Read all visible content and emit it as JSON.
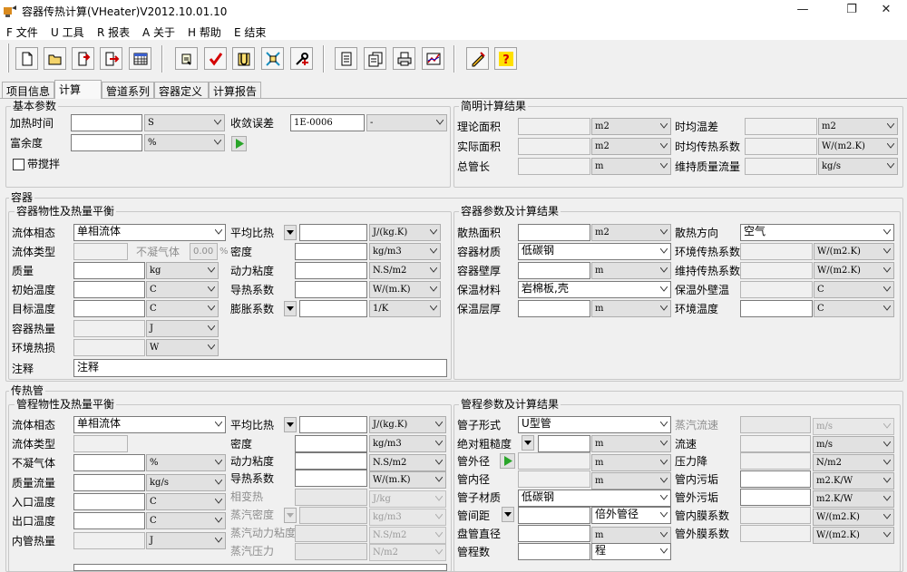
{
  "app": {
    "title": "容器传热计算(VHeater)V2012.10.01.10"
  },
  "menu": [
    "F 文件",
    "U 工具",
    "R 报表",
    "A 关于",
    "H 帮助",
    "E 结束"
  ],
  "tabs": [
    "项目信息",
    "计算",
    "管道系列",
    "容器定义",
    "计算报告"
  ],
  "basic": {
    "title": "基本参数",
    "heat_time_label": "加热时间",
    "heat_time_unit": "S",
    "margin_label": "富余度",
    "margin_unit": "%",
    "tol_label": "收敛误差",
    "tol_value": "1E-0006",
    "tol_unit": "-",
    "stir_label": "带搅拌"
  },
  "summary": {
    "title": "简明计算结果",
    "theo_area": "理论面积",
    "actual_area": "实际面积",
    "total_len": "总管长",
    "avg_dt": "时均温差",
    "avg_k": "时均传热系数",
    "maint_flow": "维持质量流量",
    "u_m2": "m2",
    "u_m": "m",
    "u_wm2k": "W/(m2.K)",
    "u_kgs": "kg/s"
  },
  "vessel": {
    "title": "容器",
    "sub_title": "容器物性及热量平衡",
    "phase_label": "流体相态",
    "phase_value": "单相流体",
    "ftype_label": "流体类型",
    "ncg_label": "不凝气体",
    "ncg_value": "0.00",
    "pct": "%",
    "mass_label": "质量",
    "mass_unit": "kg",
    "t0_label": "初始温度",
    "t0_unit": "C",
    "tt_label": "目标温度",
    "tt_unit": "C",
    "heat_label": "容器热量",
    "heat_unit": "J",
    "loss_label": "环境热损",
    "loss_unit": "W",
    "note_label": "注释",
    "note_value": "注释",
    "cp_label": "平均比热",
    "cp_unit": "J/(kg.K)",
    "rho_label": "密度",
    "rho_unit": "kg/m3",
    "mu_label": "动力粘度",
    "mu_unit": "N.S/m2",
    "k_label": "导热系数",
    "k_unit": "W/(m.K)",
    "beta_label": "膨胀系数",
    "beta_unit": "1/K"
  },
  "vparams": {
    "title": "容器参数及计算结果",
    "area_label": "散热面积",
    "area_unit": "m2",
    "mat_label": "容器材质",
    "mat_value": "低碳钢",
    "wall_label": "容器壁厚",
    "wall_unit": "m",
    "ins_label": "保温材料",
    "ins_value": "岩棉板,壳",
    "inst_label": "保温层厚",
    "inst_unit": "m",
    "dir_label": "散热方向",
    "dir_value": "空气",
    "env_h_label": "环境传热系数",
    "env_h_unit": "W/(m2.K)",
    "keep_h_label": "维持传热系数",
    "keep_h_unit": "W/(m2.K)",
    "outer_t_label": "保温外壁温",
    "outer_t_unit": "C",
    "env_t_label": "环境温度",
    "env_t_unit": "C"
  },
  "tube": {
    "title": "传热管",
    "sub_title": "管程物性及热量平衡",
    "phase_label": "流体相态",
    "phase_value": "单相流体",
    "ftype_label": "流体类型",
    "ncg_label": "不凝气体",
    "ncg_unit": "%",
    "flow_label": "质量流量",
    "flow_unit": "kg/s",
    "tin_label": "入口温度",
    "tin_unit": "C",
    "tout_label": "出口温度",
    "tout_unit": "C",
    "heat_label": "内管热量",
    "heat_unit": "J",
    "cp_label": "平均比热",
    "cp_unit": "J/(kg.K)",
    "rho_label": "密度",
    "rho_unit": "kg/m3",
    "mu_label": "动力粘度",
    "mu_unit": "N.S/m2",
    "k_label": "导热系数",
    "k_unit": "W/(m.K)",
    "latent_label": "相变热",
    "latent_unit": "J/kg",
    "vrho_label": "蒸汽密度",
    "vrho_unit": "kg/m3",
    "vmu_label": "蒸汽动力粘度",
    "vmu_unit": "N.S/m2",
    "vp_label": "蒸汽压力",
    "vp_unit": "N/m2"
  },
  "tparams": {
    "title": "管程参数及计算结果",
    "shape_label": "管子形式",
    "shape_value": "U型管",
    "rough_label": "绝对粗糙度",
    "rough_unit": "m",
    "od_label": "管外径",
    "od_unit": "m",
    "id_label": "管内径",
    "id_unit": "m",
    "mat_label": "管子材质",
    "mat_value": "低碳钢",
    "pitch_label": "管间距",
    "pitch_unit": "倍外管径",
    "coil_label": "盘管直径",
    "coil_unit": "m",
    "num_label": "管程数",
    "num_unit": "程",
    "vvel_label": "蒸汽流速",
    "vvel_unit": "m/s",
    "vel_label": "流速",
    "vel_unit": "m/s",
    "dp_label": "压力降",
    "dp_unit": "N/m2",
    "ifoul_label": "管内污垢",
    "ifoul_unit": "m2.K/W",
    "ofoul_label": "管外污垢",
    "ofoul_unit": "m2.K/W",
    "ih_label": "管内膜系数",
    "ih_unit": "W/(m2.K)",
    "oh_label": "管外膜系数",
    "oh_unit": "W/(m2.K)"
  },
  "icons": [
    "new-icon",
    "open-icon",
    "import-icon",
    "export-icon",
    "table-icon",
    "check-file-icon",
    "verify-icon",
    "u-tube-icon",
    "calc-icon",
    "settings-icon",
    "doc-icon",
    "docs-icon",
    "print-icon",
    "chart-icon",
    "edit-icon",
    "help-icon"
  ],
  "colors": {
    "play": "#2aa52a",
    "accent": "#d40000"
  }
}
